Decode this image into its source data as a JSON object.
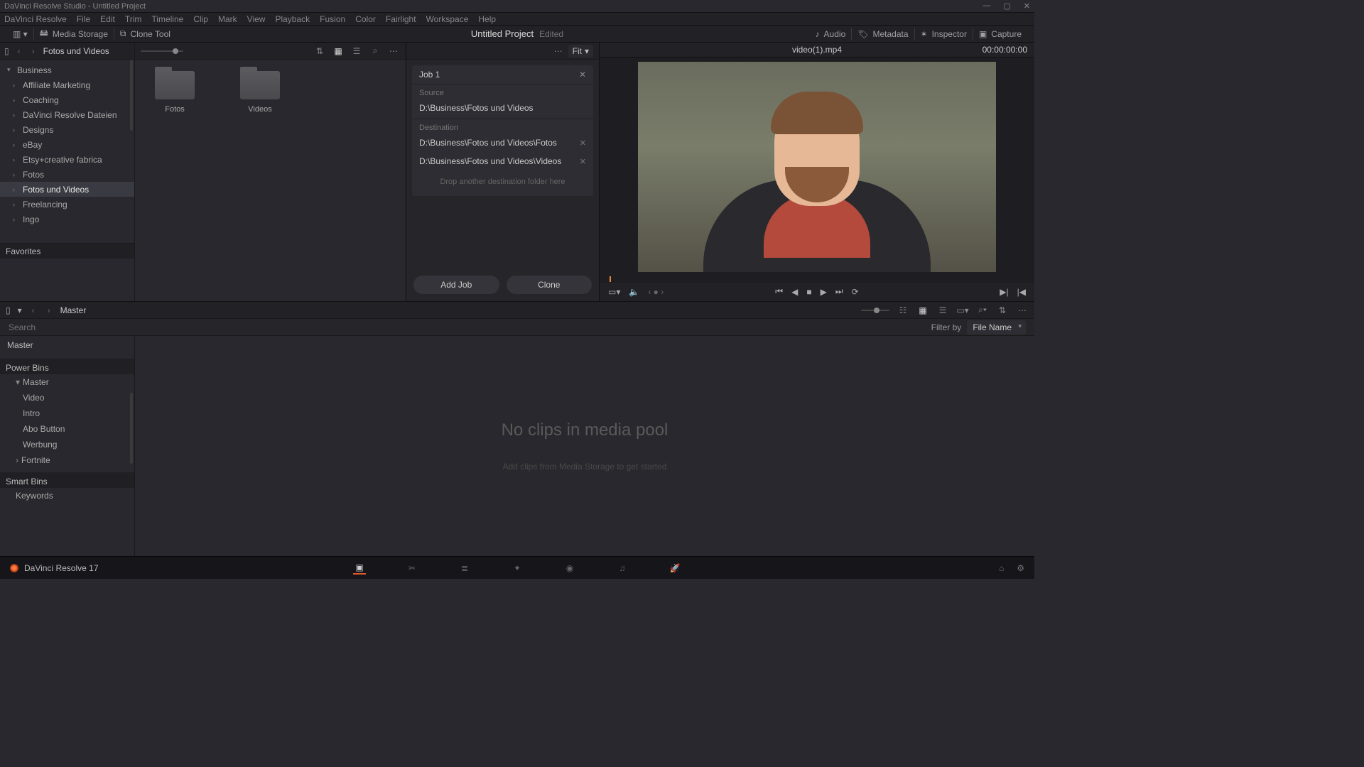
{
  "window": {
    "title": "DaVinci Resolve Studio - Untitled Project"
  },
  "menu": [
    "DaVinci Resolve",
    "File",
    "Edit",
    "Trim",
    "Timeline",
    "Clip",
    "Mark",
    "View",
    "Playback",
    "Fusion",
    "Color",
    "Fairlight",
    "Workspace",
    "Help"
  ],
  "toolbar": {
    "media_storage": "Media Storage",
    "clone_tool": "Clone Tool",
    "project": "Untitled Project",
    "edited": "Edited",
    "audio": "Audio",
    "metadata": "Metadata",
    "inspector": "Inspector",
    "capture": "Capture"
  },
  "storage": {
    "breadcrumb": "Fotos und Videos",
    "root": "Business",
    "items": [
      {
        "label": "Affiliate Marketing"
      },
      {
        "label": "Coaching"
      },
      {
        "label": "DaVinci Resolve Dateien"
      },
      {
        "label": "Designs"
      },
      {
        "label": "eBay"
      },
      {
        "label": "Etsy+creative fabrica"
      },
      {
        "label": "Fotos"
      },
      {
        "label": "Fotos und Videos",
        "selected": true
      },
      {
        "label": "Freelancing"
      },
      {
        "label": "Ingo"
      }
    ],
    "favorites": "Favorites"
  },
  "folders": [
    {
      "label": "Fotos"
    },
    {
      "label": "Videos"
    }
  ],
  "clone": {
    "fit": "Fit",
    "job": "Job 1",
    "source_label": "Source",
    "source_path": "D:\\Business\\Fotos und Videos",
    "dest_label": "Destination",
    "dest_paths": [
      "D:\\Business\\Fotos und Videos\\Fotos",
      "D:\\Business\\Fotos und Videos\\Videos"
    ],
    "drop_hint": "Drop another destination folder here",
    "add_job": "Add Job",
    "clone_btn": "Clone"
  },
  "viewer": {
    "title": "video(1).mp4",
    "tc": "00:00:00:00"
  },
  "pool": {
    "breadcrumb": "Master",
    "search_placeholder": "Search",
    "filter_label": "Filter by",
    "filter_value": "File Name",
    "master": "Master",
    "power_bins": "Power Bins",
    "power_items": [
      "Master",
      "Video",
      "Intro",
      "Abo Button",
      "Werbung",
      "Fortnite"
    ],
    "smart_bins": "Smart Bins",
    "smart_items": [
      "Keywords"
    ],
    "empty_title": "No clips in media pool",
    "empty_sub": "Add clips from Media Storage to get started"
  },
  "footer": {
    "app": "DaVinci Resolve 17"
  }
}
